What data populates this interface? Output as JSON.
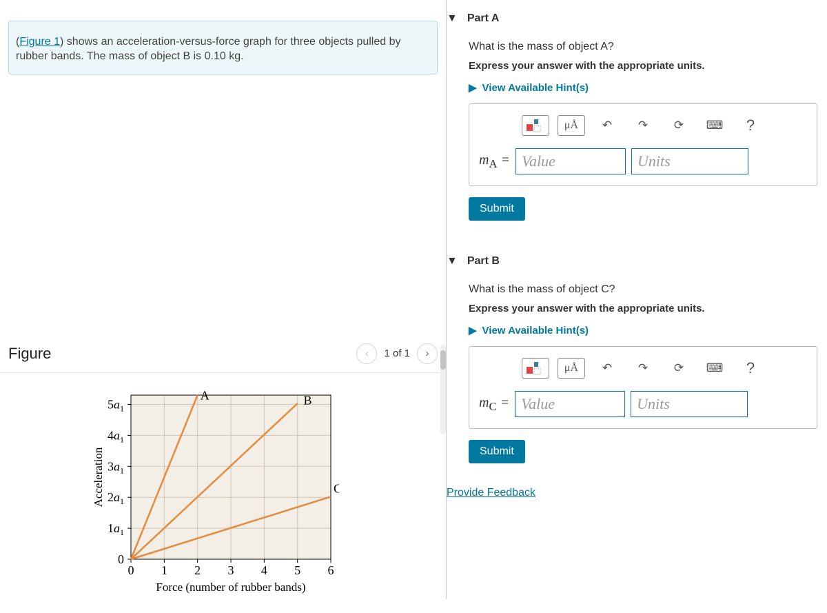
{
  "intro": {
    "link_text": "Figure 1",
    "body_pre": "(",
    "body_post": ") shows an acceleration-versus-force graph for three objects pulled by rubber bands. The mass of object B is 0.10 kg."
  },
  "figurePanel": {
    "title": "Figure",
    "page_indicator": "1 of 1"
  },
  "partA": {
    "header": "Part A",
    "question": "What is the mass of object A?",
    "note": "Express your answer with the appropriate units.",
    "hints_label": "View Available Hint(s)",
    "unit_tool": "μÅ",
    "var_label": "mA =",
    "value_placeholder": "Value",
    "units_placeholder": "Units",
    "submit_label": "Submit"
  },
  "partB": {
    "header": "Part B",
    "question": "What is the mass of object C?",
    "note": "Express your answer with the appropriate units.",
    "hints_label": "View Available Hint(s)",
    "unit_tool": "μÅ",
    "var_label": "mC =",
    "value_placeholder": "Value",
    "units_placeholder": "Units",
    "submit_label": "Submit"
  },
  "feedback_label": "Provide Feedback",
  "chart_data": {
    "type": "line",
    "title": "",
    "xlabel": "Force (number of rubber bands)",
    "ylabel": "Acceleration",
    "x_ticks": [
      "0",
      "1",
      "2",
      "3",
      "4",
      "5",
      "6"
    ],
    "y_ticks": [
      "0",
      "1a₁",
      "2a₁",
      "3a₁",
      "4a₁",
      "5a₁"
    ],
    "xlim": [
      0,
      6
    ],
    "ylim": [
      0,
      5.3
    ],
    "series": [
      {
        "name": "A",
        "x": [
          0,
          2
        ],
        "y": [
          0,
          5.3
        ]
      },
      {
        "name": "B",
        "x": [
          0,
          5
        ],
        "y": [
          0,
          5.03
        ]
      },
      {
        "name": "C",
        "x": [
          0,
          6
        ],
        "y": [
          0,
          2.02
        ]
      }
    ],
    "series_labels": {
      "A": "A",
      "B": "B",
      "C": "C"
    }
  },
  "icons": {
    "help": "?"
  }
}
